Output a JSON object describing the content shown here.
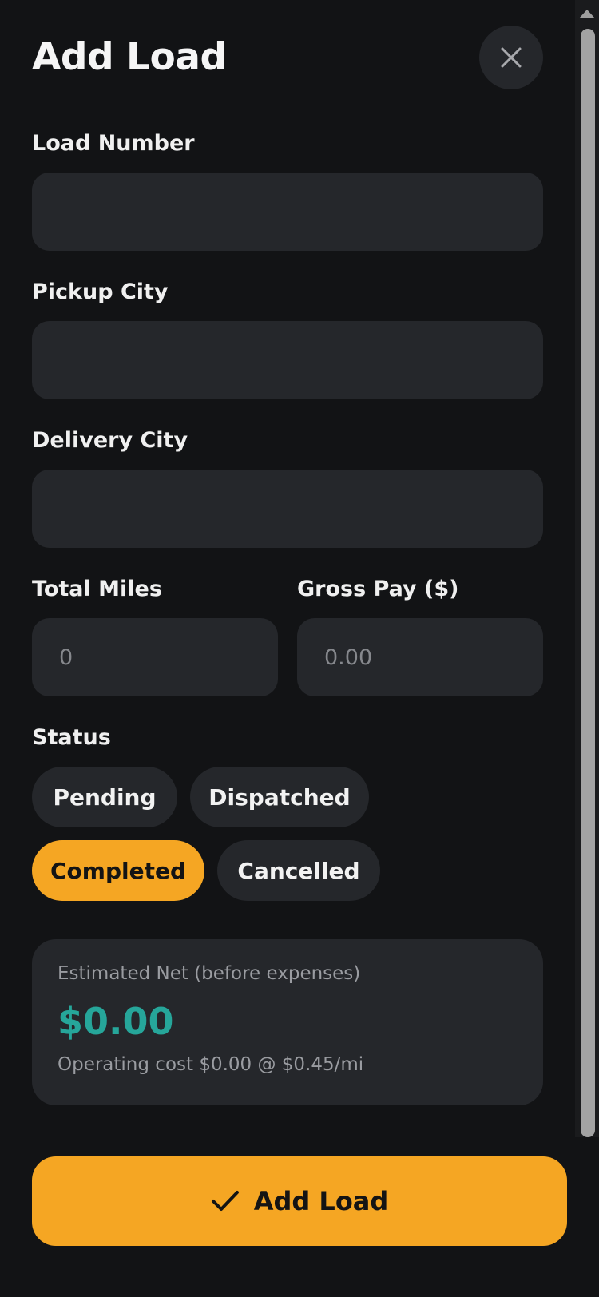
{
  "header": {
    "title": "Add Load",
    "close_icon": "close-icon"
  },
  "form": {
    "load_number": {
      "label": "Load Number",
      "value": "",
      "placeholder": ""
    },
    "pickup_city": {
      "label": "Pickup City",
      "value": "",
      "placeholder": ""
    },
    "delivery_city": {
      "label": "Delivery City",
      "value": "",
      "placeholder": ""
    },
    "total_miles": {
      "label": "Total Miles",
      "value": "",
      "placeholder": "0"
    },
    "gross_pay": {
      "label": "Gross Pay ($)",
      "value": "",
      "placeholder": "0.00"
    }
  },
  "status": {
    "label": "Status",
    "options": [
      "Pending",
      "Dispatched",
      "Completed",
      "Cancelled"
    ],
    "selected": "Completed"
  },
  "summary": {
    "label": "Estimated Net (before expenses)",
    "value": "$0.00",
    "note": "Operating cost $0.00 @ $0.45/mi"
  },
  "submit": {
    "label": "Add Load",
    "icon": "check-icon"
  },
  "colors": {
    "background": "#121315",
    "surface": "#25272b",
    "accent": "#f5a623",
    "positive": "#26a69a",
    "muted_text": "#9a9ca1"
  }
}
